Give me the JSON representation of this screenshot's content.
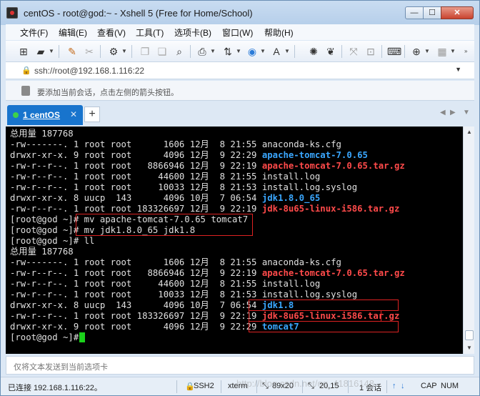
{
  "window": {
    "title": "centOS - root@god:~ - Xshell 5 (Free for Home/School)",
    "min_glyph": "—",
    "max_glyph": "☐",
    "close_glyph": "✕"
  },
  "menu": [
    "文件(F)",
    "编辑(E)",
    "查看(V)",
    "工具(T)",
    "选项卡(B)",
    "窗口(W)",
    "帮助(H)"
  ],
  "address": {
    "text": "ssh://root@192.168.1.116:22"
  },
  "hint": {
    "text": "要添加当前会话，点击左侧的箭头按钮。"
  },
  "tab": {
    "label": "1 centOS",
    "close": "✕"
  },
  "terminal": {
    "lines": [
      [
        {
          "t": "总用量 187768"
        }
      ],
      [
        {
          "t": "-rw-------. 1 root root      1606 12月  8 21:55 anaconda-ks.cfg"
        }
      ],
      [
        {
          "t": "drwxr-xr-x. 9 root root      4096 12月  9 22:29 "
        },
        {
          "t": "apache-tomcat-7.0.65",
          "c": "blue"
        }
      ],
      [
        {
          "t": "-rw-r--r--. 1 root root   8866946 12月  9 22:19 "
        },
        {
          "t": "apache-tomcat-7.0.65.tar.gz",
          "c": "red"
        }
      ],
      [
        {
          "t": "-rw-r--r--. 1 root root     44600 12月  8 21:55 install.log"
        }
      ],
      [
        {
          "t": "-rw-r--r--. 1 root root     10033 12月  8 21:53 install.log.syslog"
        }
      ],
      [
        {
          "t": "drwxr-xr-x. 8 uucp  143      4096 10月  7 06:54 "
        },
        {
          "t": "jdk1.8.0_65",
          "c": "blue"
        }
      ],
      [
        {
          "t": "-rw-r--r--. 1 root root 183326697 12月  9 22:19 "
        },
        {
          "t": "jdk-8u65-linux-i586.tar.gz",
          "c": "red"
        }
      ],
      [
        {
          "t": "[root@god ~]# mv apache-tomcat-7.0.65 tomcat7"
        }
      ],
      [
        {
          "t": "[root@god ~]# mv jdk1.8.0_65 jdk1.8"
        }
      ],
      [
        {
          "t": "[root@god ~]# ll"
        }
      ],
      [
        {
          "t": "总用量 187768"
        }
      ],
      [
        {
          "t": "-rw-------. 1 root root      1606 12月  8 21:55 anaconda-ks.cfg"
        }
      ],
      [
        {
          "t": "-rw-r--r--. 1 root root   8866946 12月  9 22:19 "
        },
        {
          "t": "apache-tomcat-7.0.65.tar.gz",
          "c": "red"
        }
      ],
      [
        {
          "t": "-rw-r--r--. 1 root root     44600 12月  8 21:55 install.log"
        }
      ],
      [
        {
          "t": "-rw-r--r--. 1 root root     10033 12月  8 21:53 install.log.syslog"
        }
      ],
      [
        {
          "t": "drwxr-xr-x. 8 uucp  143      4096 10月  7 06:54 "
        },
        {
          "t": "jdk1.8",
          "c": "blue"
        }
      ],
      [
        {
          "t": "-rw-r--r--. 1 root root 183326697 12月  9 22:19 "
        },
        {
          "t": "jdk-8u65-linux-i586.tar.gz",
          "c": "red"
        }
      ],
      [
        {
          "t": "drwxr-xr-x. 9 root root      4096 12月  9 22:29 "
        },
        {
          "t": "tomcat7",
          "c": "blue"
        }
      ],
      [
        {
          "t": "[root@god ~]# "
        }
      ]
    ]
  },
  "sendbar": {
    "placeholder": "仅将文本发送到当前选项卡"
  },
  "status": {
    "connected": "已连接 192.168.1.116:22。",
    "protocol": "SSH2",
    "terminal_type": "xterm",
    "size": "89x20",
    "cursor_pos": "20,15",
    "sessions": "1 会话",
    "caps": "CAP",
    "num": "NUM"
  },
  "watermark": "http://blog.csdn.net/qq_41816148"
}
